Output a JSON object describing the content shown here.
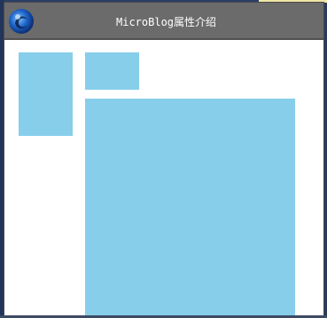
{
  "window": {
    "title": "MicroBlog属性介绍",
    "icon": "app-logo-icon"
  },
  "colors": {
    "titlebar": "#6b6b6b",
    "content_background": "#ffffff",
    "box_fill": "#87ceeb"
  }
}
